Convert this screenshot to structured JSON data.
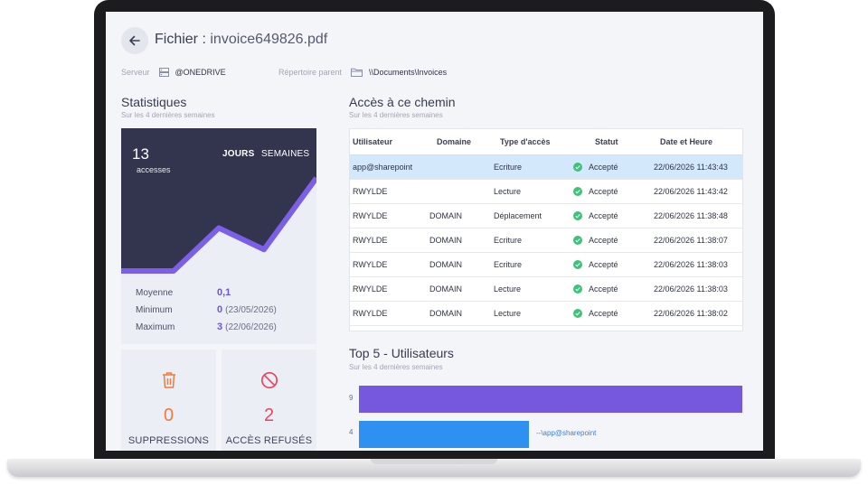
{
  "header": {
    "title_prefix": "Fichier :",
    "file_name": "invoice649826.pdf",
    "server_label": "Serveur",
    "server_value": "@ONEDRIVE",
    "parent_label": "Répertoire parent",
    "parent_value": "\\\\Documents\\Invoices"
  },
  "stats": {
    "title": "Statistiques",
    "subtitle": "Sur les 4 dernières semaines",
    "count": "13",
    "count_label": "accesses",
    "toggle_days": "JOURS",
    "toggle_weeks": "SEMAINES",
    "series": [
      0,
      0,
      6,
      3,
      13
    ],
    "average_label": "Moyenne",
    "average_value": "0,1",
    "min_label": "Minimum",
    "min_value": "0",
    "min_date": "(23/05/2026)",
    "max_label": "Maximum",
    "max_value": "3",
    "max_date": "(22/06/2026)"
  },
  "kpis": {
    "deletions_value": "0",
    "deletions_label": "SUPPRESSIONS",
    "refused_value": "2",
    "refused_label": "ACCÈS REFUSÉS"
  },
  "access": {
    "title": "Accès à ce chemin",
    "subtitle": "Sur les 4 dernières semaines",
    "columns": [
      "Utilisateur",
      "Domaine",
      "Type d'accès",
      "Statut",
      "Date et Heure"
    ],
    "rows": [
      {
        "user": "app@sharepoint",
        "domain": "",
        "type": "Ecriture",
        "status": "Accepté",
        "datetime": "22/06/2026 11:43:43"
      },
      {
        "user": "RWYLDE",
        "domain": "",
        "type": "Lecture",
        "status": "Accepté",
        "datetime": "22/06/2026 11:43:42"
      },
      {
        "user": "RWYLDE",
        "domain": "DOMAIN",
        "type": "Déplacement",
        "status": "Accepté",
        "datetime": "22/06/2026 11:38:48"
      },
      {
        "user": "RWYLDE",
        "domain": "DOMAIN",
        "type": "Ecriture",
        "status": "Accepté",
        "datetime": "22/06/2026 11:38:07"
      },
      {
        "user": "RWYLDE",
        "domain": "DOMAIN",
        "type": "Ecriture",
        "status": "Accepté",
        "datetime": "22/06/2026 11:38:03"
      },
      {
        "user": "RWYLDE",
        "domain": "DOMAIN",
        "type": "Lecture",
        "status": "Accepté",
        "datetime": "22/06/2026 11:38:03"
      },
      {
        "user": "RWYLDE",
        "domain": "DOMAIN",
        "type": "Lecture",
        "status": "Accepté",
        "datetime": "22/06/2026 11:38:02"
      }
    ]
  },
  "top_users": {
    "title": "Top 5 - Utilisateurs",
    "subtitle": "Sur les 4 dernières semaines",
    "bars": [
      {
        "value": "9",
        "name": "",
        "color": "#7558dd"
      },
      {
        "value": "4",
        "name": "--\\app@sharepoint",
        "color": "#2e90f0"
      }
    ]
  },
  "colors": {
    "accent_purple": "#6a56d8",
    "dark_panel": "#33344e",
    "ok_green": "#3cc37a",
    "warn_orange": "#ee7b3c",
    "danger_red": "#e8455f",
    "selected_row": "#d3e8fb"
  }
}
